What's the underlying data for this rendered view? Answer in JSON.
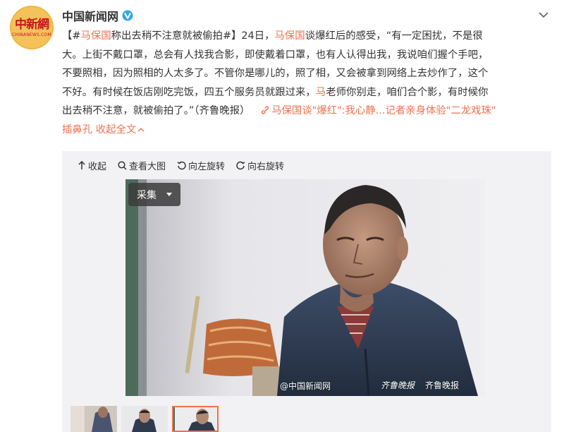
{
  "account": {
    "avatar_logo_cn": "中新網",
    "avatar_logo_en": "CHINANEWS.COM",
    "name": "中国新闻网",
    "verified_icon": "blue-v-verified-icon"
  },
  "post": {
    "line1_hashtag": "【#马保国称出去稍不注意就被偷拍#】",
    "line1_prefix": "【#",
    "line1_hashtag_name": "马保国",
    "line1_hashtag_rest": "称出去稍不注意就被偷拍#】",
    "line1_date": "24日，",
    "mention_1": "马保国",
    "text_1": "谈爆红后的感受，“有一定困扰，不是很",
    "line2": "大。上街不戴口罩，总会有人找我合影，即使戴着口罩，也有人认得出我，我说咱们握个手吧，",
    "line3": "不要照相，因为照相的人太多了。不管你是哪儿的，照了相，又会被拿到网络上去炒作了，这个",
    "line4": "不好。有时候在饭店刚吃完饭，四五个服务员就跟过来，",
    "mention_2": "马",
    "line4_rest": "老师你别走，咱们合个影，有时候你",
    "line5": "出去稍不注意，就被偷拍了。”（齐鲁晚报）",
    "article_link_prefix": "马保国",
    "article_link_text": "谈\"爆红\":我心静...记者亲身体验\"二龙戏珠\"",
    "line6": "插鼻孔",
    "collapse_label": "收起全文",
    "link_icon": "link-icon",
    "collapse_icon": "chevron-up-icon"
  },
  "toolbar": {
    "collapse": "收起",
    "view_large": "查看大图",
    "rotate_left": "向左旋转",
    "rotate_right": "向右旋转"
  },
  "photo": {
    "collect_label": "采集",
    "watermark_weibo": "@中国新闻网",
    "watermark_logo1": "齐鲁晚报",
    "watermark_logo2": "齐鲁晚报"
  },
  "colors": {
    "accent": "#eb7350",
    "text": "#333333",
    "panel_bg": "#f2f2f5",
    "verified": "#2fa7e5"
  }
}
